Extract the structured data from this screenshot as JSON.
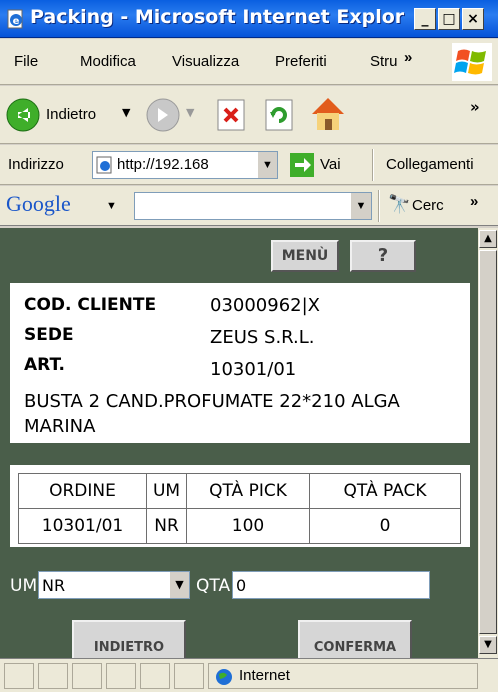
{
  "window": {
    "title": "Packing - Microsoft Internet Explore..."
  },
  "menu": [
    "File",
    "Modifica",
    "Visualizza",
    "Preferiti",
    "Stru",
    "»"
  ],
  "toolbar": {
    "back_label": "Indietro",
    "more": "»"
  },
  "address": {
    "label": "Indirizzo",
    "url": "http://192.168",
    "go_label": "Vai",
    "links_label": "Collegamenti"
  },
  "google": {
    "logo": "Google",
    "search_label": "Cerc",
    "more": "»"
  },
  "page": {
    "menu_button": "MENÙ",
    "help_button": "?",
    "cliente_label": "COD. CLIENTE",
    "cliente_value": "03000962|X",
    "sede_label": "SEDE",
    "sede_value": "ZEUS S.R.L.",
    "art_label": "ART.",
    "art_value": "10301/01",
    "description": "BUSTA 2 CAND.PROFUMATE 22*210 ALGA MARINA",
    "table": {
      "headers": [
        "ORDINE",
        "UM",
        "QTÀ PICK",
        "QTÀ PACK"
      ],
      "row": [
        "10301/01",
        "NR",
        "100",
        "0"
      ]
    },
    "um_label": "UM",
    "um_value": "NR",
    "qta_label": "QTA",
    "qta_value": "0",
    "back_button": "INDIETRO",
    "confirm_button": "CONFERMA"
  },
  "status": {
    "zone": "Internet"
  },
  "colors": {
    "background": "#4a5e4a",
    "titlebar": "#0a5fe0"
  }
}
